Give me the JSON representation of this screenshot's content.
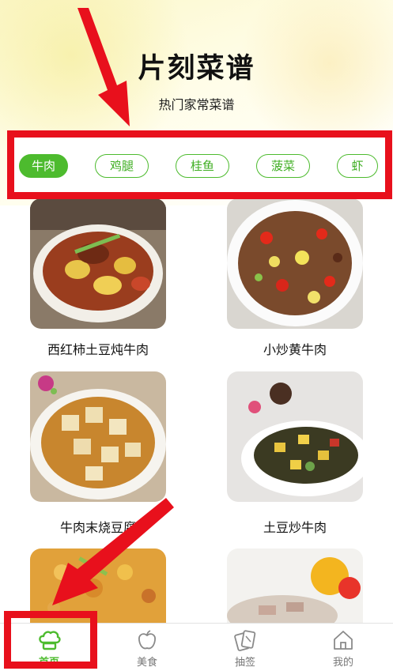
{
  "header": {
    "title": "片刻菜谱",
    "subtitle": "热门家常菜谱"
  },
  "tabs": [
    {
      "label": "牛肉",
      "active": true
    },
    {
      "label": "鸡腿",
      "active": false
    },
    {
      "label": "桂鱼",
      "active": false
    },
    {
      "label": "菠菜",
      "active": false
    },
    {
      "label": "虾",
      "active": false
    }
  ],
  "recipes": [
    {
      "name": "西红柿土豆炖牛肉"
    },
    {
      "name": "小炒黄牛肉"
    },
    {
      "name": "牛肉末烧豆腐"
    },
    {
      "name": "土豆炒牛肉"
    },
    {
      "name": ""
    },
    {
      "name": ""
    }
  ],
  "bottom_nav": [
    {
      "label": "首页",
      "icon": "chef-hat-icon",
      "active": true
    },
    {
      "label": "美食",
      "icon": "apple-icon",
      "active": false
    },
    {
      "label": "抽签",
      "icon": "cards-icon",
      "active": false
    },
    {
      "label": "我的",
      "icon": "house-icon",
      "active": false
    }
  ],
  "colors": {
    "accent": "#4dbb2e",
    "highlight": "#e8101c"
  }
}
